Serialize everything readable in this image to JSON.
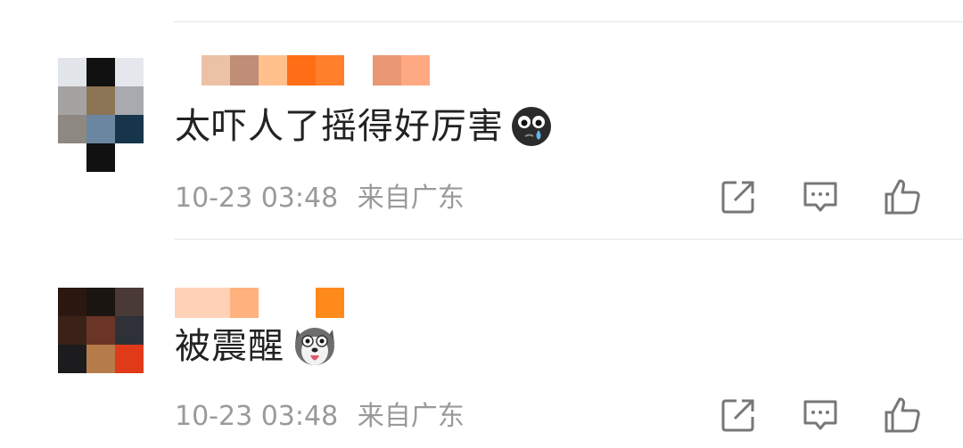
{
  "comments": [
    {
      "text": "太吓人了摇得好厉害",
      "emoji": "crying-face-emoji",
      "date": "10-23 03:48",
      "location": "来自广东",
      "avatar_colors": [
        "#e2e6ea",
        "#111111",
        "#e4e8ed",
        "#a5a3a2",
        "#8c7555",
        "#a8aab0",
        "#8d8880",
        "#6b86a1",
        "#16354a"
      ],
      "name_colors": [
        "#ebc2a5",
        "#c08d76",
        "#ffc08c",
        "#ff6e16",
        "#ff7f2b",
        "#ffffff",
        "#e99873",
        "#ffa983"
      ]
    },
    {
      "text": "被震醒",
      "emoji": "shocked-husky-emoji",
      "date": "10-23 03:48",
      "location": "来自广东",
      "avatar_colors": [
        "#2c1710",
        "#1b1512",
        "#4a3a35",
        "#3a2219",
        "#6a3526",
        "#2e3238",
        "#1c1c1e",
        "#b57c4a",
        "#e13a19"
      ],
      "name_colors": [
        "#ffd2b8",
        "#ffb27e",
        "#ffffff",
        "#ff8a1c"
      ]
    }
  ],
  "actions": {
    "share_icon": "share-icon",
    "comment_icon": "comment-icon",
    "like_icon": "like-icon"
  }
}
